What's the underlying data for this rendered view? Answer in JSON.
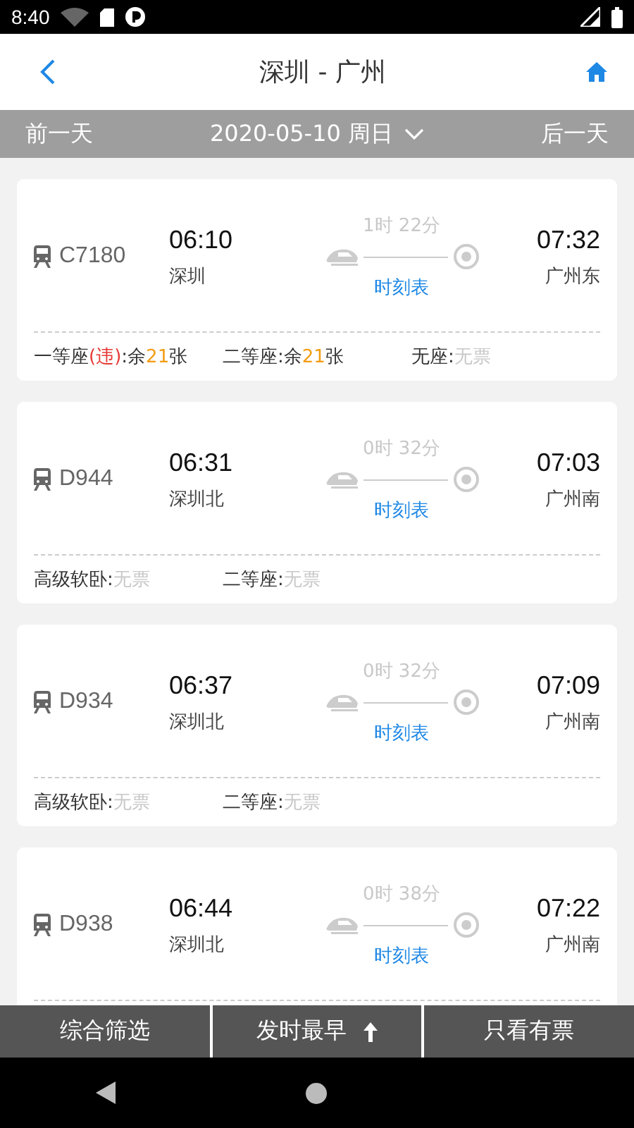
{
  "status_bar": {
    "time": "8:40"
  },
  "header": {
    "title": "深圳 - 广州"
  },
  "date_bar": {
    "prev": "前一天",
    "date": "2020-05-10 周日",
    "next": "后一天"
  },
  "trains": [
    {
      "number": "C7180",
      "depart_time": "06:10",
      "depart_station": "深圳",
      "duration": "1时 22分",
      "schedule_link": "时刻表",
      "arrive_time": "07:32",
      "arrive_station": "广州东",
      "seats": [
        {
          "name": "一等座",
          "note": "(违)",
          "separator": ":",
          "available": true,
          "before": "余",
          "count": "21",
          "after": "张"
        },
        {
          "name": "二等座",
          "separator": ":",
          "available": true,
          "before": "余",
          "count": "21",
          "after": "张"
        },
        {
          "name": "无座",
          "separator": ":",
          "available": false,
          "status": "无票"
        }
      ]
    },
    {
      "number": "D944",
      "depart_time": "06:31",
      "depart_station": "深圳北",
      "duration": "0时 32分",
      "schedule_link": "时刻表",
      "arrive_time": "07:03",
      "arrive_station": "广州南",
      "seats": [
        {
          "name": "高级软卧",
          "separator": ":",
          "available": false,
          "status": "无票"
        },
        {
          "name": "二等座",
          "separator": ":",
          "available": false,
          "status": "无票"
        }
      ]
    },
    {
      "number": "D934",
      "depart_time": "06:37",
      "depart_station": "深圳北",
      "duration": "0时 32分",
      "schedule_link": "时刻表",
      "arrive_time": "07:09",
      "arrive_station": "广州南",
      "seats": [
        {
          "name": "高级软卧",
          "separator": ":",
          "available": false,
          "status": "无票"
        },
        {
          "name": "二等座",
          "separator": ":",
          "available": false,
          "status": "无票"
        }
      ]
    },
    {
      "number": "D938",
      "depart_time": "06:44",
      "depart_station": "深圳北",
      "duration": "0时 38分",
      "schedule_link": "时刻表",
      "arrive_time": "07:22",
      "arrive_station": "广州南"
    }
  ],
  "bottom_bar": [
    {
      "label": "综合筛选",
      "sort_arrow": false
    },
    {
      "label": "发时最早",
      "sort_arrow": true
    },
    {
      "label": "只看有票",
      "sort_arrow": false
    }
  ]
}
